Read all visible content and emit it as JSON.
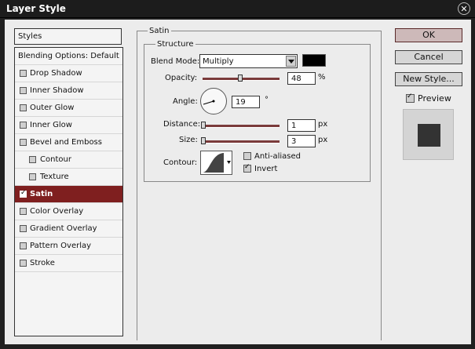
{
  "window": {
    "title": "Layer Style"
  },
  "styles_panel": {
    "header": "Styles",
    "blending": "Blending Options: Default",
    "items": [
      {
        "label": "Drop Shadow",
        "checked": false,
        "selected": false,
        "indent": 0
      },
      {
        "label": "Inner Shadow",
        "checked": false,
        "selected": false,
        "indent": 0
      },
      {
        "label": "Outer Glow",
        "checked": false,
        "selected": false,
        "indent": 0
      },
      {
        "label": "Inner Glow",
        "checked": false,
        "selected": false,
        "indent": 0
      },
      {
        "label": "Bevel and Emboss",
        "checked": false,
        "selected": false,
        "indent": 0
      },
      {
        "label": "Contour",
        "checked": false,
        "selected": false,
        "indent": 1
      },
      {
        "label": "Texture",
        "checked": false,
        "selected": false,
        "indent": 1
      },
      {
        "label": "Satin",
        "checked": true,
        "selected": true,
        "indent": 0
      },
      {
        "label": "Color Overlay",
        "checked": false,
        "selected": false,
        "indent": 0
      },
      {
        "label": "Gradient Overlay",
        "checked": false,
        "selected": false,
        "indent": 0
      },
      {
        "label": "Pattern Overlay",
        "checked": false,
        "selected": false,
        "indent": 0
      },
      {
        "label": "Stroke",
        "checked": false,
        "selected": false,
        "indent": 0
      }
    ]
  },
  "satin": {
    "group_title": "Satin",
    "structure_title": "Structure",
    "blend_mode_label": "Blend Mode:",
    "blend_mode_value": "Multiply",
    "color": "#000000",
    "opacity_label": "Opacity:",
    "opacity_value": "48",
    "opacity_unit": "%",
    "angle_label": "Angle:",
    "angle_value": "19",
    "angle_unit": "°",
    "distance_label": "Distance:",
    "distance_value": "1",
    "distance_unit": "px",
    "size_label": "Size:",
    "size_value": "3",
    "size_unit": "px",
    "contour_label": "Contour:",
    "anti_aliased_label": "Anti-aliased",
    "anti_aliased_checked": false,
    "invert_label": "Invert",
    "invert_checked": true
  },
  "buttons": {
    "ok": "OK",
    "cancel": "Cancel",
    "new_style": "New Style...",
    "preview_label": "Preview",
    "preview_checked": true
  },
  "icons": {
    "close": "close-icon",
    "dropdown": "chevron-down-icon"
  }
}
